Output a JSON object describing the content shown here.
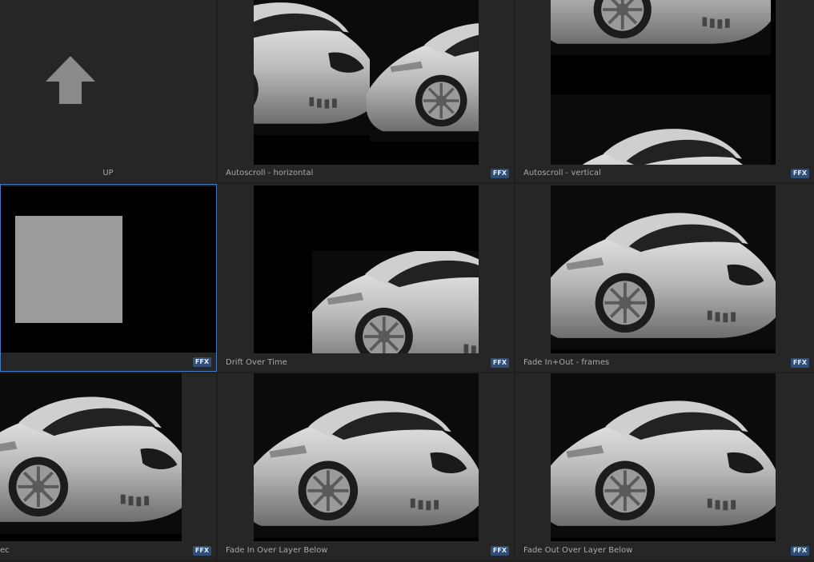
{
  "items": [
    {
      "label": "UP",
      "badge": ""
    },
    {
      "label": "Autoscroll - horizontal",
      "badge": "FFX"
    },
    {
      "label": "Autoscroll - vertical",
      "badge": "FFX"
    },
    {
      "label": "",
      "badge": "FFX"
    },
    {
      "label": "Drift Over Time",
      "badge": "FFX"
    },
    {
      "label": "Fade In+Out - frames",
      "badge": "FFX"
    },
    {
      "label": "ec",
      "badge": "FFX"
    },
    {
      "label": "Fade In Over Layer Below",
      "badge": "FFX"
    },
    {
      "label": "Fade Out Over Layer Below",
      "badge": "FFX"
    }
  ],
  "colors": {
    "background": "#1f1f1f",
    "cell": "#262626",
    "selection": "#4a78c9",
    "badge": "#2f4f78",
    "caption_text": "#a9a9a9"
  },
  "icons": {
    "up": "up-arrow-icon",
    "badge": "ffx-badge"
  }
}
